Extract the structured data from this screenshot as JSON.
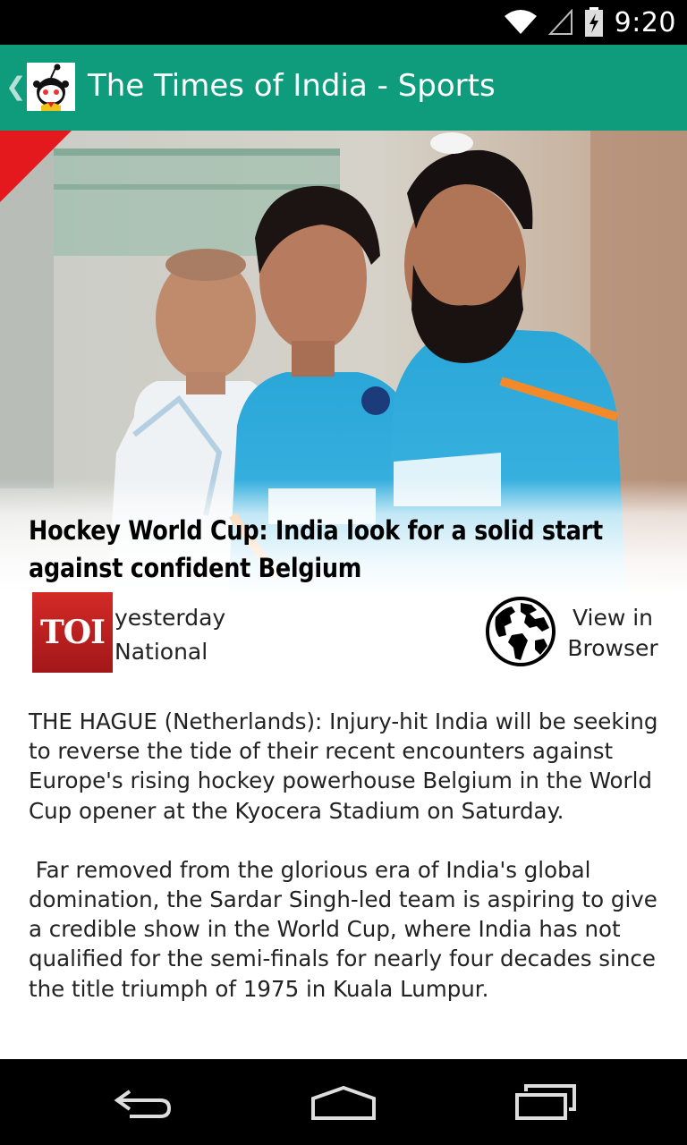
{
  "status_bar": {
    "time": "9:20",
    "icons": [
      "wifi-icon",
      "signal-icon",
      "battery-charging-icon"
    ]
  },
  "action_bar": {
    "title": "The Times of India - Sports",
    "back_glyph": "❮"
  },
  "article": {
    "headline": "Hockey World Cup: India look for a solid start against confident Belgium",
    "source_logo_text": "TOI",
    "time": "yesterday",
    "category": "National",
    "view_in_browser": "View in Browser",
    "paragraphs": [
      "THE HAGUE (Netherlands): Injury-hit India will be seeking to reverse the tide of their recent encounters against Europe's rising hockey powerhouse Belgium in the World Cup opener at the Kyocera Stadium on Saturday.",
      " Far removed from the glorious era of India's global domination, the Sardar Singh-led team is aspiring to give a credible show in the World Cup, where India has not qualified for the semi-finals for nearly four decades since the title triumph of 1975 in Kuala Lumpur."
    ]
  },
  "nav_bar": {
    "buttons": [
      "back-nav-icon",
      "home-nav-icon",
      "recents-nav-icon"
    ]
  },
  "colors": {
    "action_bar": "#0f9c7d",
    "ribbon": "#e3191d",
    "toi_logo": "#c0201f"
  }
}
